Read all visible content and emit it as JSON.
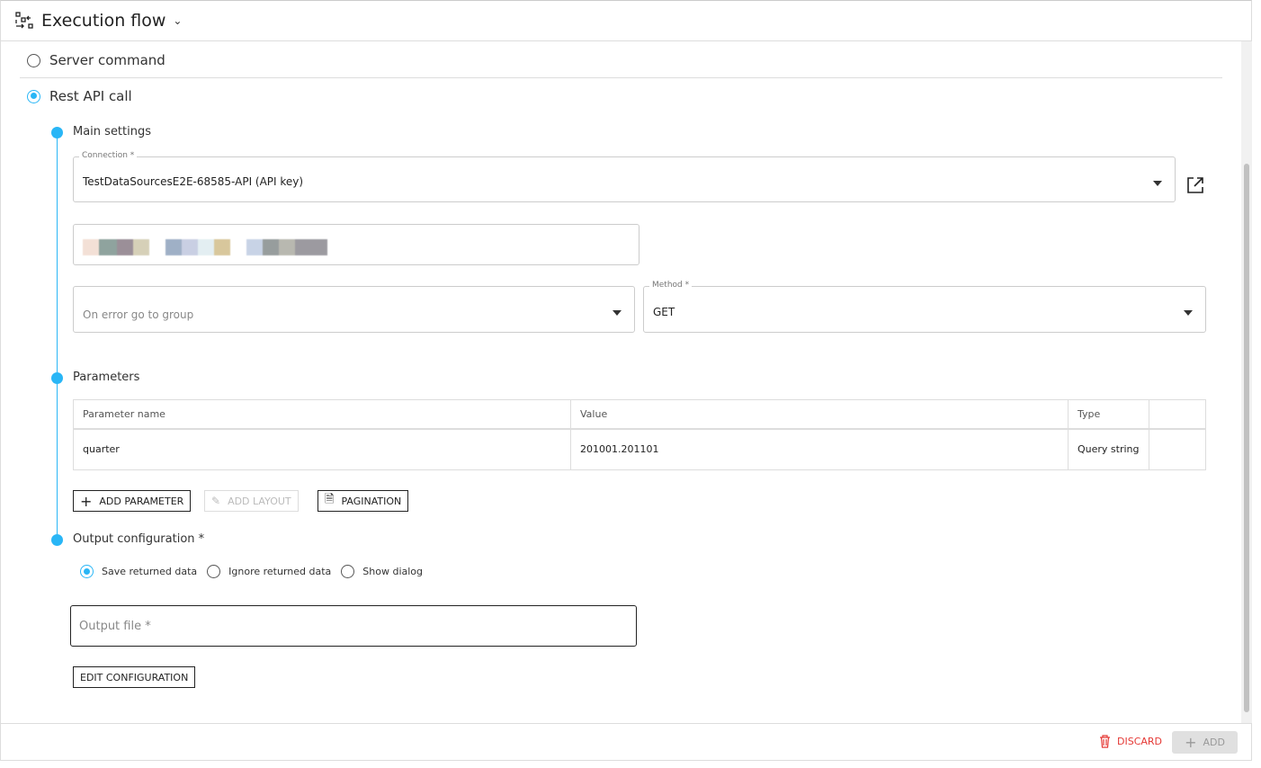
{
  "header": {
    "title": "Execution flow",
    "icon": "flow-icon",
    "chevron": "chevron-down-icon"
  },
  "mode": {
    "options": [
      {
        "label": "Server command",
        "selected": false
      },
      {
        "label": "Rest API call",
        "selected": true
      }
    ]
  },
  "main_settings": {
    "title": "Main settings",
    "connection": {
      "label": "Connection *",
      "value": "TestDataSourcesE2E-68585-API (API key)"
    },
    "on_error": {
      "placeholder": "On error go to group"
    },
    "method": {
      "label": "Method *",
      "value": "GET"
    }
  },
  "parameters": {
    "title": "Parameters",
    "columns": [
      "Parameter name",
      "Value",
      "Type",
      ""
    ],
    "rows": [
      [
        "quarter",
        "201001.201101",
        "Query string",
        ""
      ]
    ],
    "add_parameter": "ADD PARAMETER",
    "add_layout": "ADD LAYOUT",
    "pagination": "PAGINATION"
  },
  "output": {
    "title": "Output configuration *",
    "options": [
      {
        "label": "Save returned data",
        "selected": true
      },
      {
        "label": "Ignore returned data",
        "selected": false
      },
      {
        "label": "Show dialog",
        "selected": false
      }
    ],
    "output_file_placeholder": "Output file *",
    "edit_configuration": "EDIT CONFIGURATION"
  },
  "footer": {
    "discard": "DISCARD",
    "add": "ADD"
  },
  "colors": {
    "accent": "#29b6f6",
    "danger": "#e53935"
  }
}
